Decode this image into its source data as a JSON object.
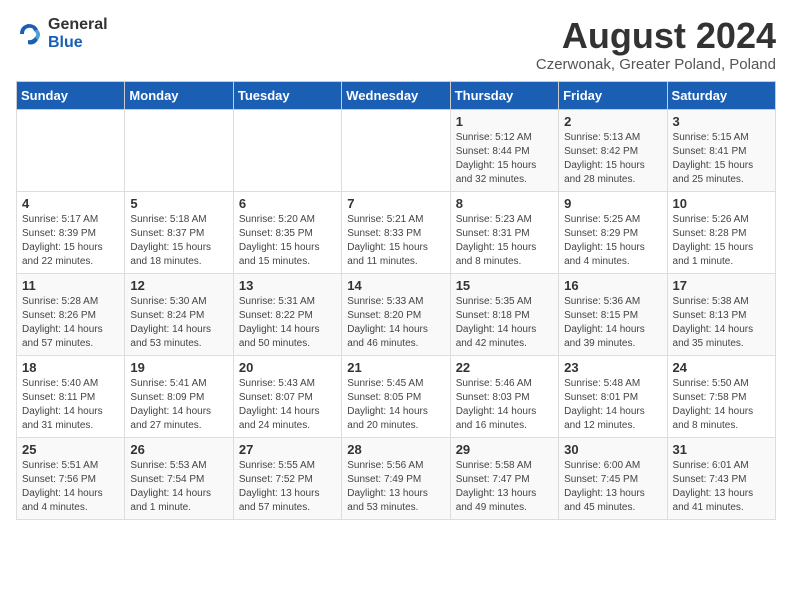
{
  "logo": {
    "general": "General",
    "blue": "Blue"
  },
  "title": "August 2024",
  "subtitle": "Czerwonak, Greater Poland, Poland",
  "days_of_week": [
    "Sunday",
    "Monday",
    "Tuesday",
    "Wednesday",
    "Thursday",
    "Friday",
    "Saturday"
  ],
  "weeks": [
    [
      {
        "day": "",
        "info": ""
      },
      {
        "day": "",
        "info": ""
      },
      {
        "day": "",
        "info": ""
      },
      {
        "day": "",
        "info": ""
      },
      {
        "day": "1",
        "info": "Sunrise: 5:12 AM\nSunset: 8:44 PM\nDaylight: 15 hours\nand 32 minutes."
      },
      {
        "day": "2",
        "info": "Sunrise: 5:13 AM\nSunset: 8:42 PM\nDaylight: 15 hours\nand 28 minutes."
      },
      {
        "day": "3",
        "info": "Sunrise: 5:15 AM\nSunset: 8:41 PM\nDaylight: 15 hours\nand 25 minutes."
      }
    ],
    [
      {
        "day": "4",
        "info": "Sunrise: 5:17 AM\nSunset: 8:39 PM\nDaylight: 15 hours\nand 22 minutes."
      },
      {
        "day": "5",
        "info": "Sunrise: 5:18 AM\nSunset: 8:37 PM\nDaylight: 15 hours\nand 18 minutes."
      },
      {
        "day": "6",
        "info": "Sunrise: 5:20 AM\nSunset: 8:35 PM\nDaylight: 15 hours\nand 15 minutes."
      },
      {
        "day": "7",
        "info": "Sunrise: 5:21 AM\nSunset: 8:33 PM\nDaylight: 15 hours\nand 11 minutes."
      },
      {
        "day": "8",
        "info": "Sunrise: 5:23 AM\nSunset: 8:31 PM\nDaylight: 15 hours\nand 8 minutes."
      },
      {
        "day": "9",
        "info": "Sunrise: 5:25 AM\nSunset: 8:29 PM\nDaylight: 15 hours\nand 4 minutes."
      },
      {
        "day": "10",
        "info": "Sunrise: 5:26 AM\nSunset: 8:28 PM\nDaylight: 15 hours\nand 1 minute."
      }
    ],
    [
      {
        "day": "11",
        "info": "Sunrise: 5:28 AM\nSunset: 8:26 PM\nDaylight: 14 hours\nand 57 minutes."
      },
      {
        "day": "12",
        "info": "Sunrise: 5:30 AM\nSunset: 8:24 PM\nDaylight: 14 hours\nand 53 minutes."
      },
      {
        "day": "13",
        "info": "Sunrise: 5:31 AM\nSunset: 8:22 PM\nDaylight: 14 hours\nand 50 minutes."
      },
      {
        "day": "14",
        "info": "Sunrise: 5:33 AM\nSunset: 8:20 PM\nDaylight: 14 hours\nand 46 minutes."
      },
      {
        "day": "15",
        "info": "Sunrise: 5:35 AM\nSunset: 8:18 PM\nDaylight: 14 hours\nand 42 minutes."
      },
      {
        "day": "16",
        "info": "Sunrise: 5:36 AM\nSunset: 8:15 PM\nDaylight: 14 hours\nand 39 minutes."
      },
      {
        "day": "17",
        "info": "Sunrise: 5:38 AM\nSunset: 8:13 PM\nDaylight: 14 hours\nand 35 minutes."
      }
    ],
    [
      {
        "day": "18",
        "info": "Sunrise: 5:40 AM\nSunset: 8:11 PM\nDaylight: 14 hours\nand 31 minutes."
      },
      {
        "day": "19",
        "info": "Sunrise: 5:41 AM\nSunset: 8:09 PM\nDaylight: 14 hours\nand 27 minutes."
      },
      {
        "day": "20",
        "info": "Sunrise: 5:43 AM\nSunset: 8:07 PM\nDaylight: 14 hours\nand 24 minutes."
      },
      {
        "day": "21",
        "info": "Sunrise: 5:45 AM\nSunset: 8:05 PM\nDaylight: 14 hours\nand 20 minutes."
      },
      {
        "day": "22",
        "info": "Sunrise: 5:46 AM\nSunset: 8:03 PM\nDaylight: 14 hours\nand 16 minutes."
      },
      {
        "day": "23",
        "info": "Sunrise: 5:48 AM\nSunset: 8:01 PM\nDaylight: 14 hours\nand 12 minutes."
      },
      {
        "day": "24",
        "info": "Sunrise: 5:50 AM\nSunset: 7:58 PM\nDaylight: 14 hours\nand 8 minutes."
      }
    ],
    [
      {
        "day": "25",
        "info": "Sunrise: 5:51 AM\nSunset: 7:56 PM\nDaylight: 14 hours\nand 4 minutes."
      },
      {
        "day": "26",
        "info": "Sunrise: 5:53 AM\nSunset: 7:54 PM\nDaylight: 14 hours\nand 1 minute."
      },
      {
        "day": "27",
        "info": "Sunrise: 5:55 AM\nSunset: 7:52 PM\nDaylight: 13 hours\nand 57 minutes."
      },
      {
        "day": "28",
        "info": "Sunrise: 5:56 AM\nSunset: 7:49 PM\nDaylight: 13 hours\nand 53 minutes."
      },
      {
        "day": "29",
        "info": "Sunrise: 5:58 AM\nSunset: 7:47 PM\nDaylight: 13 hours\nand 49 minutes."
      },
      {
        "day": "30",
        "info": "Sunrise: 6:00 AM\nSunset: 7:45 PM\nDaylight: 13 hours\nand 45 minutes."
      },
      {
        "day": "31",
        "info": "Sunrise: 6:01 AM\nSunset: 7:43 PM\nDaylight: 13 hours\nand 41 minutes."
      }
    ]
  ]
}
